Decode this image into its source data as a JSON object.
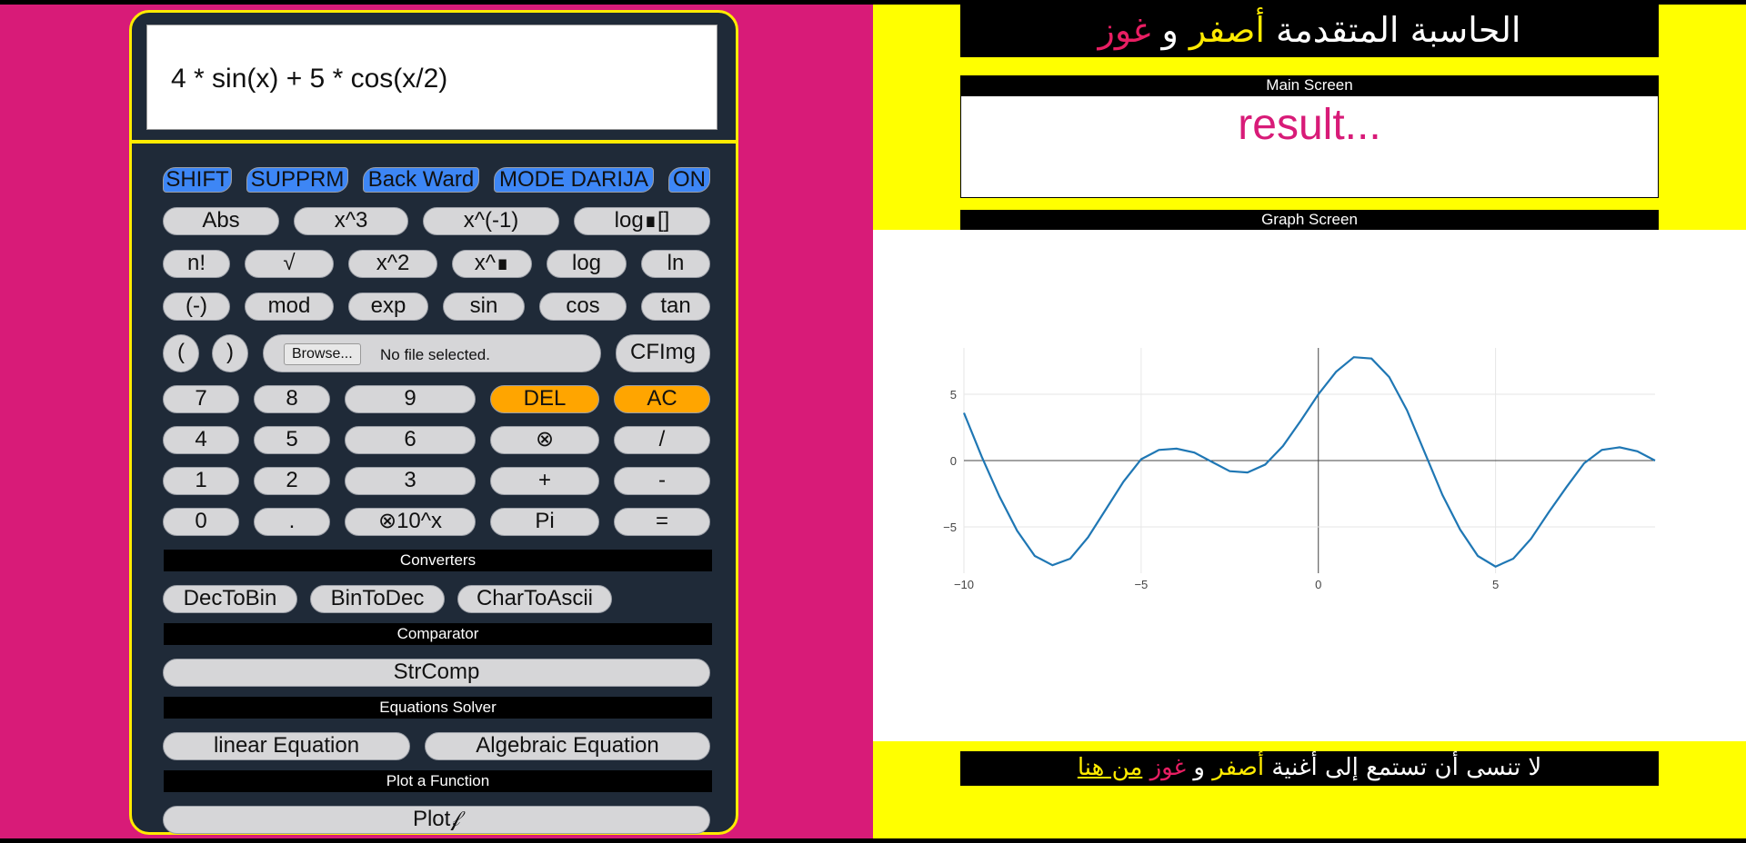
{
  "calculator": {
    "expression": "4 * sin(x) + 5 * cos(x/2)",
    "top_buttons": [
      "SHIFT",
      "SUPPRM",
      "Back Ward",
      "MODE DARIJA",
      "ON"
    ],
    "row1": [
      "Abs",
      "x^3",
      "x^(-1)",
      "log∎[]"
    ],
    "row2": [
      "n!",
      "√",
      "x^2",
      "x^∎",
      "log",
      "ln"
    ],
    "row3": [
      "(-)",
      "mod",
      "exp",
      "sin",
      "cos",
      "tan"
    ],
    "row4": {
      "open_paren": "(",
      "close_paren": ")",
      "browse": "Browse...",
      "file_status": "No file selected.",
      "cfimg": "CFImg"
    },
    "row5": [
      "7",
      "8",
      "9",
      "DEL",
      "AC"
    ],
    "row6": [
      "4",
      "5",
      "6",
      "⊗",
      "/"
    ],
    "row7": [
      "1",
      "2",
      "3",
      "+",
      "-"
    ],
    "row8": [
      "0",
      ".",
      "⊗10^x",
      "Pi",
      "="
    ],
    "converters_label": "Converters",
    "converters": [
      "DecToBin",
      "BinToDec",
      "CharToAscii"
    ],
    "comparator_label": "Comparator",
    "comparator": "StrComp",
    "equations_label": "Equations Solver",
    "equations": [
      "linear Equation",
      "Algebraic Equation"
    ],
    "plot_label": "Plot a Function",
    "plot": "Plot𝒻"
  },
  "header": {
    "title_part1": "الحاسبة المتقدمة",
    "title_part2": "أصفر",
    "title_and": "و",
    "title_part3": "غوز"
  },
  "main_screen": {
    "label": "Main Screen",
    "result": "result..."
  },
  "graph_screen": {
    "label": "Graph Screen"
  },
  "footer": {
    "text1": "لا تنسى أن تستمع إلى أغنية",
    "yellow": "أصفر",
    "and": "و",
    "pink": "غوز",
    "link": "من هنا"
  },
  "colors": {
    "pink": "#d81b78",
    "yellow": "#ffff00",
    "calc_bg": "#1f2a38",
    "blue_btn": "#3d86f5",
    "orange_btn": "#ffa500",
    "line": "#1f77b4"
  },
  "chart_data": {
    "type": "line",
    "x": [
      -10,
      -9.5,
      -9,
      -8.5,
      -8,
      -7.5,
      -7,
      -6.5,
      -6,
      -5.5,
      -5,
      -4.5,
      -4,
      -3.5,
      -3,
      -2.5,
      -2,
      -1.5,
      -1,
      -0.5,
      0,
      0.5,
      1,
      1.5,
      2,
      2.5,
      3,
      3.5,
      4,
      4.5,
      5,
      5.5,
      6,
      6.5,
      7,
      7.5,
      8,
      8.5,
      9,
      9.5
    ],
    "series": [
      {
        "values": [
          3.6,
          0.3,
          -2.7,
          -5.3,
          -7.2,
          -7.9,
          -7.4,
          -5.8,
          -3.7,
          -1.6,
          0.1,
          0.8,
          0.9,
          0.6,
          -0.1,
          -0.8,
          -0.9,
          -0.3,
          1.1,
          3.0,
          5.0,
          6.7,
          7.8,
          7.7,
          6.3,
          3.8,
          0.6,
          -2.6,
          -5.2,
          -7.2,
          -8.0,
          -7.4,
          -5.9,
          -3.9,
          -2.0,
          -0.2,
          0.8,
          1.0,
          0.7,
          0.0
        ]
      }
    ],
    "xticks": [
      -10,
      -5,
      0,
      5
    ],
    "yticks": [
      -5,
      0,
      5
    ],
    "xlim": [
      -10,
      9.5
    ],
    "ylim": [
      -8.5,
      8.5
    ],
    "grid": true
  }
}
